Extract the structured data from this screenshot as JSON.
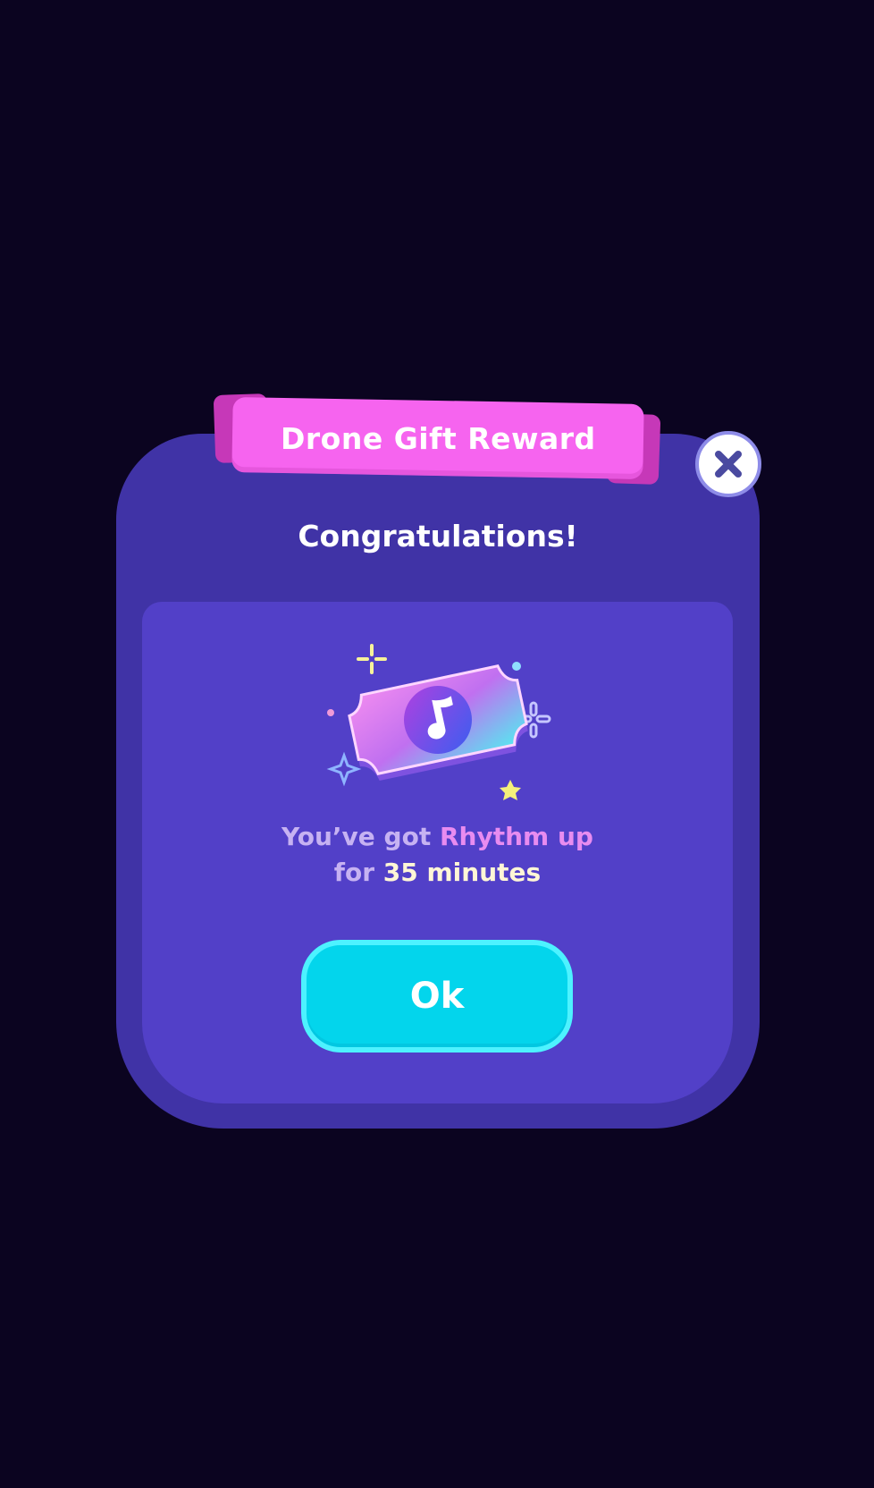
{
  "dialog": {
    "title": "Drone Gift Reward",
    "heading": "Congratulations!",
    "message": {
      "prefix": "You’ve got",
      "item": "Rhythm up",
      "for_word": "for",
      "duration": "35 minutes"
    },
    "ok_label": "Ok"
  },
  "icons": {
    "close": "close-icon",
    "reward": "music-ticket-icon"
  },
  "colors": {
    "background": "#0b0420",
    "dialog": "#4033a6",
    "panel": "#5240c8",
    "ribbon": "#f664ef",
    "ok_button": "#03d5ec",
    "highlight": "#e88cf0"
  }
}
